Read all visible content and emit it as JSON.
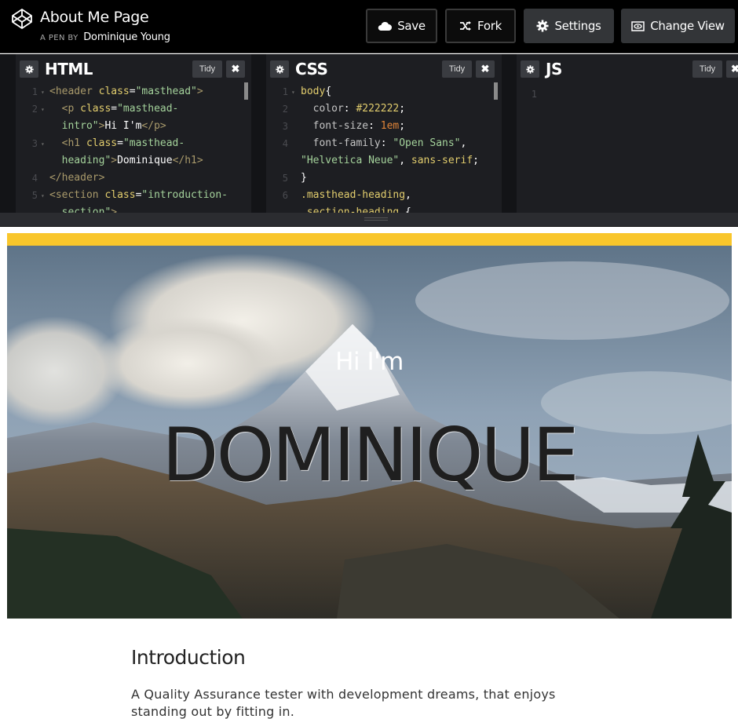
{
  "header": {
    "title": "About Me Page",
    "by_label": "A PEN BY",
    "author": "Dominique Young",
    "buttons": {
      "save": "Save",
      "fork": "Fork",
      "settings": "Settings",
      "change_view": "Change View"
    }
  },
  "editors": {
    "html": {
      "title": "HTML",
      "tidy": "Tidy",
      "close": "✖"
    },
    "css": {
      "title": "CSS",
      "tidy": "Tidy",
      "close": "✖"
    },
    "js": {
      "title": "JS",
      "tidy": "Tidy",
      "close": "✖",
      "line_numbers": [
        "1"
      ]
    }
  },
  "html_code": {
    "line_numbers": [
      "1",
      "2",
      "3",
      "4",
      "5"
    ],
    "lines": [
      [
        [
          "t-tag",
          "<header "
        ],
        [
          "t-attr",
          "class"
        ],
        [
          "t-txt",
          "="
        ],
        [
          "t-str",
          "\"masthead\""
        ],
        [
          "t-tag",
          ">"
        ]
      ],
      [
        [
          "t-txt",
          "  "
        ],
        [
          "t-tag",
          "<p "
        ],
        [
          "t-attr",
          "class"
        ],
        [
          "t-txt",
          "="
        ],
        [
          "t-str",
          "\"masthead-"
        ]
      ],
      [
        [
          "t-str",
          "  intro\""
        ],
        [
          "t-tag",
          ">"
        ],
        [
          "t-txt",
          "Hi I'm"
        ],
        [
          "t-tag",
          "</p>"
        ]
      ],
      [
        [
          "t-txt",
          "  "
        ],
        [
          "t-tag",
          "<h1 "
        ],
        [
          "t-attr",
          "class"
        ],
        [
          "t-txt",
          "="
        ],
        [
          "t-str",
          "\"masthead-"
        ]
      ],
      [
        [
          "t-str",
          "  heading\""
        ],
        [
          "t-tag",
          ">"
        ],
        [
          "t-txt",
          "Dominique"
        ],
        [
          "t-tag",
          "</h1>"
        ]
      ],
      [
        [
          "t-tag",
          "</header>"
        ]
      ],
      [
        [
          "t-tag",
          "<section "
        ],
        [
          "t-attr",
          "class"
        ],
        [
          "t-txt",
          "="
        ],
        [
          "t-str",
          "\"introduction-"
        ]
      ],
      [
        [
          "t-str",
          "  section\""
        ],
        [
          "t-tag",
          ">"
        ]
      ]
    ]
  },
  "css_code": {
    "line_numbers": [
      "1",
      "2",
      "3",
      "4",
      "",
      "5",
      "6"
    ],
    "lines": [
      [
        [
          "t-kw",
          "body"
        ],
        [
          "t-txt",
          "{"
        ]
      ],
      [
        [
          "t-txt",
          "  "
        ],
        [
          "t-prop",
          "color"
        ],
        [
          "t-txt",
          ": "
        ],
        [
          "t-kw",
          "#222222"
        ],
        [
          "t-txt",
          ";"
        ]
      ],
      [
        [
          "t-txt",
          "  "
        ],
        [
          "t-prop",
          "font-size"
        ],
        [
          "t-txt",
          ": "
        ],
        [
          "t-num",
          "1em"
        ],
        [
          "t-txt",
          ";"
        ]
      ],
      [
        [
          "t-txt",
          "  "
        ],
        [
          "t-prop",
          "font-family"
        ],
        [
          "t-txt",
          ": "
        ],
        [
          "t-str",
          "\"Open Sans\""
        ],
        [
          "t-txt",
          ","
        ]
      ],
      [
        [
          "t-str",
          "\"Helvetica Neue\""
        ],
        [
          "t-txt",
          ", "
        ],
        [
          "t-kw",
          "sans-serif"
        ],
        [
          "t-txt",
          ";"
        ]
      ],
      [
        [
          "t-txt",
          "}"
        ]
      ],
      [
        [
          "t-kw",
          ".masthead-heading"
        ],
        [
          "t-txt",
          ","
        ]
      ],
      [
        [
          "t-kw",
          ".section-heading"
        ],
        [
          "t-txt",
          " {"
        ]
      ]
    ]
  },
  "preview": {
    "intro": "Hi I'm",
    "name": "Dominique",
    "section_heading": "Introduction",
    "section_text": "A Quality Assurance tester with development dreams, that enjoys standing out by fitting in."
  },
  "colors": {
    "accent_yellow": "#f9c62b",
    "topbar": "#000000",
    "editor_bg": "#1d1e22"
  }
}
